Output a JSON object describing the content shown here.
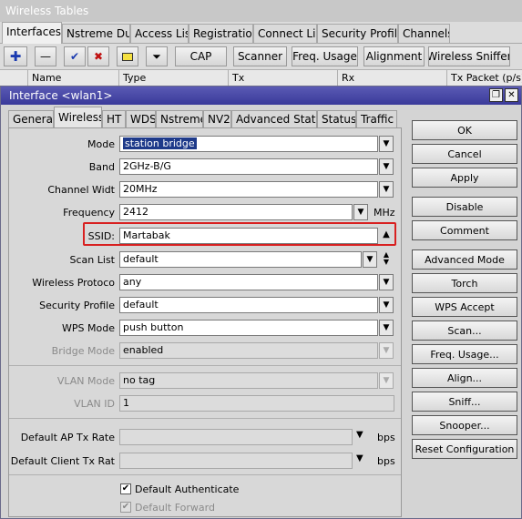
{
  "outer": {
    "title": "Wireless Tables",
    "tabs": [
      "Interfaces",
      "Nstreme Dual",
      "Access List",
      "Registration",
      "Connect List",
      "Security Profiles",
      "Channels"
    ],
    "toolbar": {
      "cap": "CAP",
      "scanner": "Scanner",
      "freq_usage": "Freq. Usage",
      "alignment": "Alignment",
      "wireless_sniffer": "Wireless Sniffer"
    },
    "columns": [
      "Name",
      "Type",
      "Tx",
      "Rx",
      "Tx Packet (p/s)"
    ]
  },
  "dialog": {
    "title": "Interface <wlan1>",
    "tabs": [
      "General",
      "Wireless",
      "HT",
      "WDS",
      "Nstreme",
      "NV2",
      "Advanced Status",
      "Status",
      "Traffic"
    ],
    "active_tab": "Wireless",
    "fields": {
      "mode": {
        "label": "Mode",
        "value": "station bridge"
      },
      "band": {
        "label": "Band",
        "value": "2GHz-B/G"
      },
      "channel_width": {
        "label": "Channel Widt",
        "value": "20MHz"
      },
      "frequency": {
        "label": "Frequency",
        "value": "2412",
        "unit": "MHz"
      },
      "ssid": {
        "label": "SSID:",
        "value": "Martabak"
      },
      "scan_list": {
        "label": "Scan List",
        "value": "default"
      },
      "wireless_protocol": {
        "label": "Wireless Protoco",
        "value": "any"
      },
      "security_profile": {
        "label": "Security Profile",
        "value": "default"
      },
      "wps_mode": {
        "label": "WPS Mode",
        "value": "push button"
      },
      "bridge_mode": {
        "label": "Bridge Mode",
        "value": "enabled"
      },
      "vlan_mode": {
        "label": "VLAN Mode",
        "value": "no tag"
      },
      "vlan_id": {
        "label": "VLAN ID",
        "value": "1"
      },
      "default_ap_tx_rate": {
        "label": "Default AP Tx Rate",
        "value": "",
        "unit": "bps"
      },
      "default_client_tx_rate": {
        "label": "Default Client Tx Rat",
        "value": "",
        "unit": "bps"
      }
    },
    "checkboxes": {
      "default_authenticate": {
        "label": "Default Authenticate",
        "checked": true
      },
      "default_forward": {
        "label": "Default Forward",
        "checked": true
      }
    },
    "buttons": {
      "ok": "OK",
      "cancel": "Cancel",
      "apply": "Apply",
      "disable": "Disable",
      "comment": "Comment",
      "advanced_mode": "Advanced Mode",
      "torch": "Torch",
      "wps_accept": "WPS Accept",
      "scan": "Scan...",
      "freq_usage": "Freq. Usage...",
      "align": "Align...",
      "sniff": "Sniff...",
      "snooper": "Snooper...",
      "reset_configuration": "Reset Configuration"
    }
  },
  "colors": {
    "title_bar": "#3a3a9a",
    "highlight": "#d82020",
    "selection": "#1e3a8a"
  }
}
